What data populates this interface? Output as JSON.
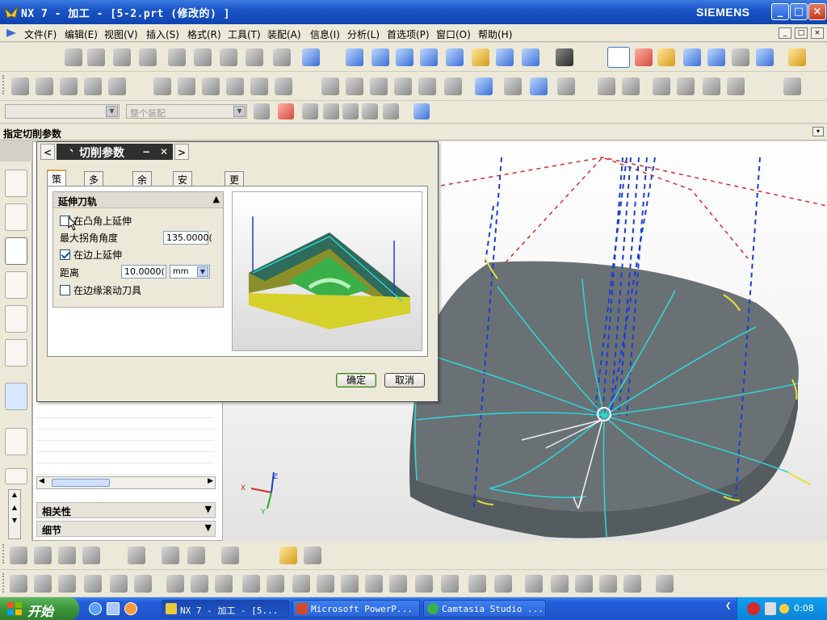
{
  "window": {
    "title": "NX 7 - 加工 - [5-2.prt (修改的) ]",
    "brand": "SIEMENS",
    "minimize": "_",
    "maximize": "□",
    "close": "×"
  },
  "menubar": {
    "items": [
      "文件(F)",
      "编辑(E)",
      "视图(V)",
      "插入(S)",
      "格式(R)",
      "工具(T)",
      "装配(A)",
      "信息(I)",
      "分析(L)",
      "首选项(P)",
      "窗口(O)",
      "帮助(H)"
    ]
  },
  "toolbar": {
    "start_label": "开始",
    "selection_filter": "",
    "assembly_scope": "整个装配"
  },
  "cue_line": {
    "text": "指定切削参数"
  },
  "dialog": {
    "title": "切削参数",
    "tabs": [
      "策略",
      "多条刀路",
      "余量",
      "安全设置",
      "更多"
    ],
    "active_tab": "策略",
    "group_title": "延伸刀轨",
    "options": {
      "extend_convex_corner": {
        "label": "在凸角上延伸",
        "checked": false
      },
      "max_angle_label": "最大拐角角度",
      "max_angle_value": "135.0000(",
      "extend_edge": {
        "label": "在边上延伸",
        "checked": true
      },
      "distance_label": "距离",
      "distance_value": "10.0000(",
      "distance_unit": "mm",
      "roll_tool": {
        "label": "在边缘滚动刀具",
        "checked": false
      }
    },
    "ok_label": "确定",
    "cancel_label": "取消"
  },
  "navigator": {
    "sections": [
      {
        "label": "相关性"
      },
      {
        "label": "细节"
      }
    ]
  },
  "viewport": {
    "wcs_labels": [
      "X",
      "Y",
      "Z"
    ]
  },
  "taskbar": {
    "start_label": "开始",
    "tasks": [
      {
        "label": "NX 7 - 加工 - [5...",
        "active": true
      },
      {
        "label": "Microsoft PowerP...",
        "active": false
      },
      {
        "label": "Camtasia Studio ...",
        "active": false
      }
    ],
    "clock": "0:08"
  },
  "colors": {
    "xp_blue": "#245edb",
    "toolpath_cyan": "#2fd3d3",
    "toolpath_blue_dash": "#1a3fcf",
    "toolpath_red_dash": "#d42a2a",
    "part_gray": "#6d7478"
  }
}
